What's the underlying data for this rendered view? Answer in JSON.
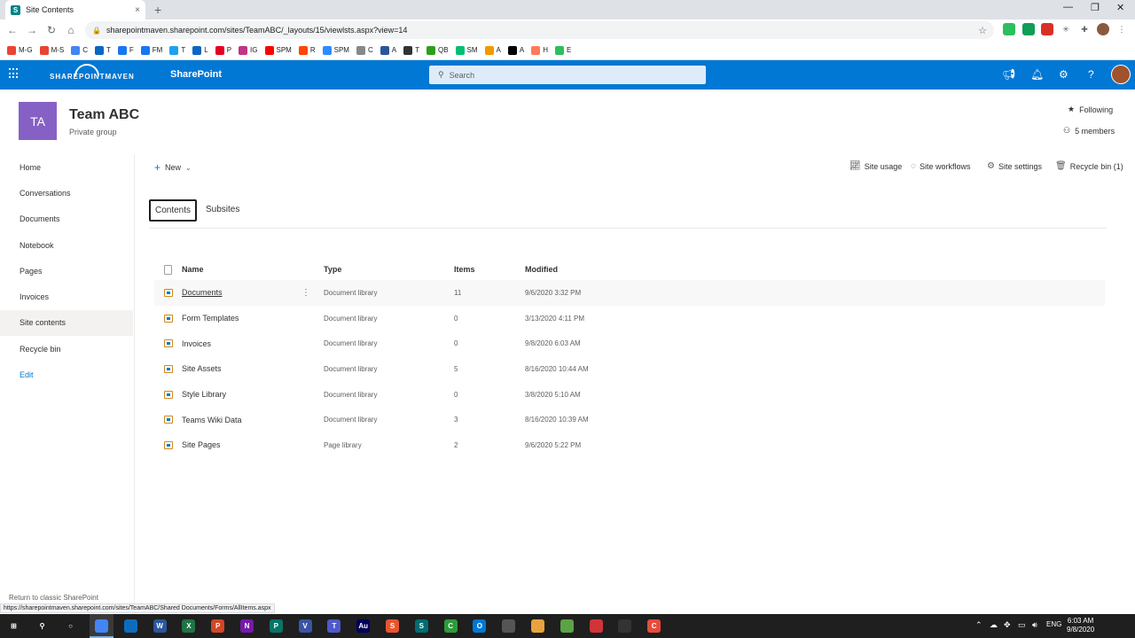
{
  "browser": {
    "tab_title": "Site Contents",
    "tab_favicon": "S",
    "url": "sharepointmaven.sharepoint.com/sites/TeamABC/_layouts/15/viewlsts.aspx?view=14",
    "new_tab": "+",
    "close": "×",
    "bookmarks": [
      {
        "label": "M-G",
        "color": "#ea4335"
      },
      {
        "label": "M-S",
        "color": "#ea4335"
      },
      {
        "label": "C",
        "color": "#4285f4"
      },
      {
        "label": "T",
        "color": "#0a66c2"
      },
      {
        "label": "F",
        "color": "#1877f2"
      },
      {
        "label": "FM",
        "color": "#1877f2"
      },
      {
        "label": "T",
        "color": "#1da1f2"
      },
      {
        "label": "L",
        "color": "#0a66c2"
      },
      {
        "label": "P",
        "color": "#e60023"
      },
      {
        "label": "IG",
        "color": "#c13584"
      },
      {
        "label": "SPM",
        "color": "#ff0000"
      },
      {
        "label": "R",
        "color": "#ff4500"
      },
      {
        "label": "SPM",
        "color": "#2d8cff"
      },
      {
        "label": "C",
        "color": "#888888"
      },
      {
        "label": "A",
        "color": "#2b579a"
      },
      {
        "label": "T",
        "color": "#333333"
      },
      {
        "label": "QB",
        "color": "#2ca01c"
      },
      {
        "label": "SM",
        "color": "#00bf6f"
      },
      {
        "label": "A",
        "color": "#f29900"
      },
      {
        "label": "A",
        "color": "#000000"
      },
      {
        "label": "H",
        "color": "#ff7a59"
      },
      {
        "label": "E",
        "color": "#2dbe60"
      }
    ]
  },
  "suitebar": {
    "logo_text": "SHAREPOINTMAVEN",
    "app_name": "SharePoint",
    "search_placeholder": "Search"
  },
  "site": {
    "logo_initials": "TA",
    "title": "Team ABC",
    "subtitle": "Private group",
    "following": "Following",
    "members": "5 members"
  },
  "nav": {
    "items": [
      {
        "label": "Home"
      },
      {
        "label": "Conversations"
      },
      {
        "label": "Documents"
      },
      {
        "label": "Notebook"
      },
      {
        "label": "Pages"
      },
      {
        "label": "Invoices"
      },
      {
        "label": "Site contents"
      },
      {
        "label": "Recycle bin"
      },
      {
        "label": "Edit"
      }
    ],
    "active_index": 6
  },
  "commandbar": {
    "new": "New",
    "site_usage": "Site usage",
    "site_workflows": "Site workflows",
    "site_settings": "Site settings",
    "recycle_bin": "Recycle bin (1)"
  },
  "pivot": {
    "contents": "Contents",
    "subsites": "Subsites"
  },
  "list": {
    "columns": {
      "name": "Name",
      "type": "Type",
      "items": "Items",
      "modified": "Modified"
    },
    "rows": [
      {
        "name": "Documents",
        "type": "Document library",
        "items": "11",
        "modified": "9/6/2020 3:32 PM"
      },
      {
        "name": "Form Templates",
        "type": "Document library",
        "items": "0",
        "modified": "3/13/2020 4:11 PM"
      },
      {
        "name": "Invoices",
        "type": "Document library",
        "items": "0",
        "modified": "9/8/2020 6:03 AM"
      },
      {
        "name": "Site Assets",
        "type": "Document library",
        "items": "5",
        "modified": "8/16/2020 10:44 AM"
      },
      {
        "name": "Style Library",
        "type": "Document library",
        "items": "0",
        "modified": "3/8/2020 5:10 AM"
      },
      {
        "name": "Teams Wiki Data",
        "type": "Document library",
        "items": "3",
        "modified": "8/16/2020 10:39 AM"
      },
      {
        "name": "Site Pages",
        "type": "Page library",
        "items": "2",
        "modified": "9/6/2020 5:22 PM"
      }
    ]
  },
  "footer": {
    "classic_link": "Return to classic SharePoint",
    "status_url": "https://sharepointmaven.sharepoint.com/sites/TeamABC/Shared Documents/Forms/AllItems.aspx"
  },
  "taskbar": {
    "lang": "ENG",
    "time": "6:03 AM",
    "date": "9/8/2020",
    "apps": [
      {
        "label": "",
        "color": "#4285f4"
      },
      {
        "label": "",
        "color": "#0f6cbd"
      },
      {
        "label": "W",
        "color": "#2b579a"
      },
      {
        "label": "X",
        "color": "#217346"
      },
      {
        "label": "P",
        "color": "#d24726"
      },
      {
        "label": "N",
        "color": "#7719aa"
      },
      {
        "label": "P",
        "color": "#077568"
      },
      {
        "label": "V",
        "color": "#3955a3"
      },
      {
        "label": "T",
        "color": "#5059c9"
      },
      {
        "label": "Au",
        "color": "#00005b"
      },
      {
        "label": "S",
        "color": "#e8542f"
      },
      {
        "label": "S",
        "color": "#036c70"
      },
      {
        "label": "C",
        "color": "#2e9b3a"
      },
      {
        "label": "O",
        "color": "#0078d4"
      },
      {
        "label": "",
        "color": "#555555"
      },
      {
        "label": "",
        "color": "#e8a33d"
      },
      {
        "label": "",
        "color": "#5ba345"
      },
      {
        "label": "",
        "color": "#d13438"
      },
      {
        "label": "",
        "color": "#333333"
      },
      {
        "label": "C",
        "color": "#e74c3c"
      }
    ]
  }
}
